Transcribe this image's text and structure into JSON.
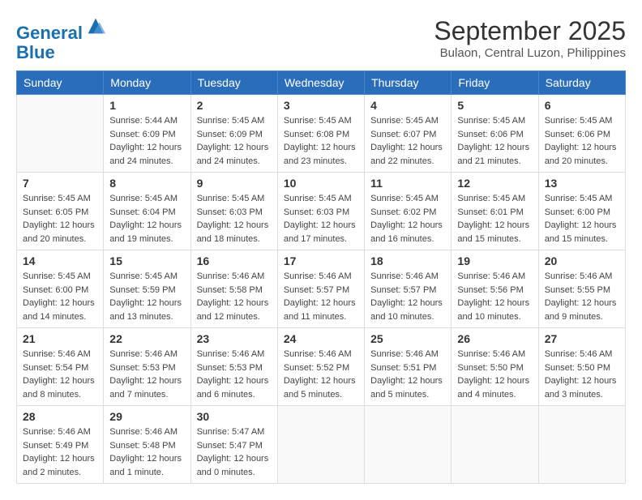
{
  "header": {
    "logo_line1": "General",
    "logo_line2": "Blue",
    "month_title": "September 2025",
    "subtitle": "Bulaon, Central Luzon, Philippines"
  },
  "weekdays": [
    "Sunday",
    "Monday",
    "Tuesday",
    "Wednesday",
    "Thursday",
    "Friday",
    "Saturday"
  ],
  "weeks": [
    [
      {
        "day": null,
        "info": null
      },
      {
        "day": "1",
        "info": "Sunrise: 5:44 AM\nSunset: 6:09 PM\nDaylight: 12 hours\nand 24 minutes."
      },
      {
        "day": "2",
        "info": "Sunrise: 5:45 AM\nSunset: 6:09 PM\nDaylight: 12 hours\nand 24 minutes."
      },
      {
        "day": "3",
        "info": "Sunrise: 5:45 AM\nSunset: 6:08 PM\nDaylight: 12 hours\nand 23 minutes."
      },
      {
        "day": "4",
        "info": "Sunrise: 5:45 AM\nSunset: 6:07 PM\nDaylight: 12 hours\nand 22 minutes."
      },
      {
        "day": "5",
        "info": "Sunrise: 5:45 AM\nSunset: 6:06 PM\nDaylight: 12 hours\nand 21 minutes."
      },
      {
        "day": "6",
        "info": "Sunrise: 5:45 AM\nSunset: 6:06 PM\nDaylight: 12 hours\nand 20 minutes."
      }
    ],
    [
      {
        "day": "7",
        "info": "Sunrise: 5:45 AM\nSunset: 6:05 PM\nDaylight: 12 hours\nand 20 minutes."
      },
      {
        "day": "8",
        "info": "Sunrise: 5:45 AM\nSunset: 6:04 PM\nDaylight: 12 hours\nand 19 minutes."
      },
      {
        "day": "9",
        "info": "Sunrise: 5:45 AM\nSunset: 6:03 PM\nDaylight: 12 hours\nand 18 minutes."
      },
      {
        "day": "10",
        "info": "Sunrise: 5:45 AM\nSunset: 6:03 PM\nDaylight: 12 hours\nand 17 minutes."
      },
      {
        "day": "11",
        "info": "Sunrise: 5:45 AM\nSunset: 6:02 PM\nDaylight: 12 hours\nand 16 minutes."
      },
      {
        "day": "12",
        "info": "Sunrise: 5:45 AM\nSunset: 6:01 PM\nDaylight: 12 hours\nand 15 minutes."
      },
      {
        "day": "13",
        "info": "Sunrise: 5:45 AM\nSunset: 6:00 PM\nDaylight: 12 hours\nand 15 minutes."
      }
    ],
    [
      {
        "day": "14",
        "info": "Sunrise: 5:45 AM\nSunset: 6:00 PM\nDaylight: 12 hours\nand 14 minutes."
      },
      {
        "day": "15",
        "info": "Sunrise: 5:45 AM\nSunset: 5:59 PM\nDaylight: 12 hours\nand 13 minutes."
      },
      {
        "day": "16",
        "info": "Sunrise: 5:46 AM\nSunset: 5:58 PM\nDaylight: 12 hours\nand 12 minutes."
      },
      {
        "day": "17",
        "info": "Sunrise: 5:46 AM\nSunset: 5:57 PM\nDaylight: 12 hours\nand 11 minutes."
      },
      {
        "day": "18",
        "info": "Sunrise: 5:46 AM\nSunset: 5:57 PM\nDaylight: 12 hours\nand 10 minutes."
      },
      {
        "day": "19",
        "info": "Sunrise: 5:46 AM\nSunset: 5:56 PM\nDaylight: 12 hours\nand 10 minutes."
      },
      {
        "day": "20",
        "info": "Sunrise: 5:46 AM\nSunset: 5:55 PM\nDaylight: 12 hours\nand 9 minutes."
      }
    ],
    [
      {
        "day": "21",
        "info": "Sunrise: 5:46 AM\nSunset: 5:54 PM\nDaylight: 12 hours\nand 8 minutes."
      },
      {
        "day": "22",
        "info": "Sunrise: 5:46 AM\nSunset: 5:53 PM\nDaylight: 12 hours\nand 7 minutes."
      },
      {
        "day": "23",
        "info": "Sunrise: 5:46 AM\nSunset: 5:53 PM\nDaylight: 12 hours\nand 6 minutes."
      },
      {
        "day": "24",
        "info": "Sunrise: 5:46 AM\nSunset: 5:52 PM\nDaylight: 12 hours\nand 5 minutes."
      },
      {
        "day": "25",
        "info": "Sunrise: 5:46 AM\nSunset: 5:51 PM\nDaylight: 12 hours\nand 5 minutes."
      },
      {
        "day": "26",
        "info": "Sunrise: 5:46 AM\nSunset: 5:50 PM\nDaylight: 12 hours\nand 4 minutes."
      },
      {
        "day": "27",
        "info": "Sunrise: 5:46 AM\nSunset: 5:50 PM\nDaylight: 12 hours\nand 3 minutes."
      }
    ],
    [
      {
        "day": "28",
        "info": "Sunrise: 5:46 AM\nSunset: 5:49 PM\nDaylight: 12 hours\nand 2 minutes."
      },
      {
        "day": "29",
        "info": "Sunrise: 5:46 AM\nSunset: 5:48 PM\nDaylight: 12 hours\nand 1 minute."
      },
      {
        "day": "30",
        "info": "Sunrise: 5:47 AM\nSunset: 5:47 PM\nDaylight: 12 hours\nand 0 minutes."
      },
      {
        "day": null,
        "info": null
      },
      {
        "day": null,
        "info": null
      },
      {
        "day": null,
        "info": null
      },
      {
        "day": null,
        "info": null
      }
    ]
  ]
}
